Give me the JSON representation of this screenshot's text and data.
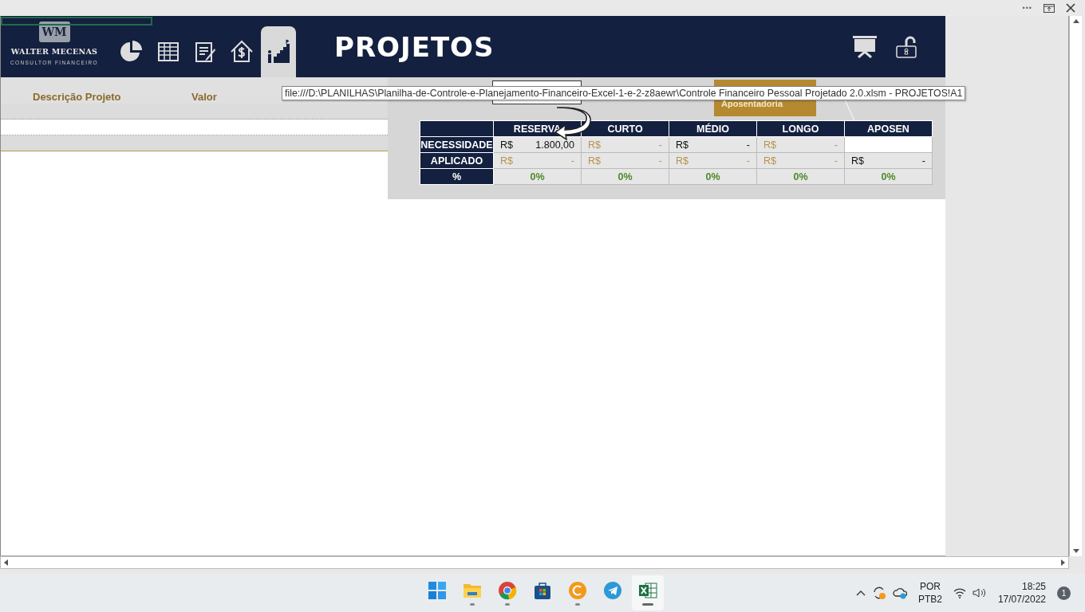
{
  "window": {
    "more": "•••"
  },
  "header": {
    "logo_initials": "WM",
    "logo_name": "WALTER MECENAS",
    "logo_subtitle": "CONSULTOR FINANCEIRO",
    "title": "PROJETOS",
    "nav": [
      {
        "kind": "chart",
        "selected": false
      },
      {
        "kind": "table",
        "selected": false
      },
      {
        "kind": "notes",
        "selected": false
      },
      {
        "kind": "house",
        "selected": false
      },
      {
        "kind": "stairs",
        "selected": true
      }
    ]
  },
  "projects": {
    "columns": [
      "Descrição Projeto",
      "Valor"
    ]
  },
  "goal_box": {
    "label": "Aposentadoria"
  },
  "tooltip": "file:///D:\\PLANILHAS\\Planilha-de-Controle-e-Planejamento-Financeiro-Excel-1-e-2-z8aewr\\Controle Financeiro Pessoal Projetado 2.0.xlsm - PROJETOS!A1",
  "summary": {
    "columns": [
      "RESERVA",
      "CURTO",
      "MÉDIO",
      "LONGO",
      "APOSEN"
    ],
    "rows": [
      {
        "label": "NECESSIDADE",
        "cells": [
          {
            "kind": "money",
            "currency": "R$",
            "value": "1.800,00",
            "filled": true
          },
          {
            "kind": "money",
            "currency": "R$",
            "value": "-",
            "filled": false
          },
          {
            "kind": "money",
            "currency": "R$",
            "value": "-",
            "filled": true
          },
          {
            "kind": "money",
            "currency": "R$",
            "value": "-",
            "filled": false
          },
          {
            "kind": "empty"
          }
        ]
      },
      {
        "label": "APLICADO",
        "cells": [
          {
            "kind": "money",
            "currency": "R$",
            "value": "-",
            "filled": false
          },
          {
            "kind": "money",
            "currency": "R$",
            "value": "-",
            "filled": false
          },
          {
            "kind": "money",
            "currency": "R$",
            "value": "-",
            "filled": false
          },
          {
            "kind": "money",
            "currency": "R$",
            "value": "-",
            "filled": false
          },
          {
            "kind": "money",
            "currency": "R$",
            "value": "-",
            "filled": true
          }
        ]
      },
      {
        "label": "%",
        "cells": [
          {
            "kind": "percent",
            "value": "0%"
          },
          {
            "kind": "percent",
            "value": "0%"
          },
          {
            "kind": "percent",
            "value": "0%"
          },
          {
            "kind": "percent",
            "value": "0%"
          },
          {
            "kind": "percent",
            "value": "0%"
          }
        ]
      }
    ]
  },
  "taskbar": {
    "apps": [
      {
        "kind": "start",
        "running": false,
        "selected": false
      },
      {
        "kind": "folder",
        "running": true,
        "selected": false
      },
      {
        "kind": "browser",
        "running": true,
        "selected": false
      },
      {
        "kind": "store",
        "running": false,
        "selected": false
      },
      {
        "kind": "coin",
        "running": true,
        "selected": false
      },
      {
        "kind": "telegram",
        "running": false,
        "selected": false
      },
      {
        "kind": "excel",
        "running": true,
        "selected": true
      }
    ],
    "language": "POR",
    "layout": "PTB2",
    "time": "18:25",
    "date": "17/07/2022",
    "notifications": "1"
  }
}
